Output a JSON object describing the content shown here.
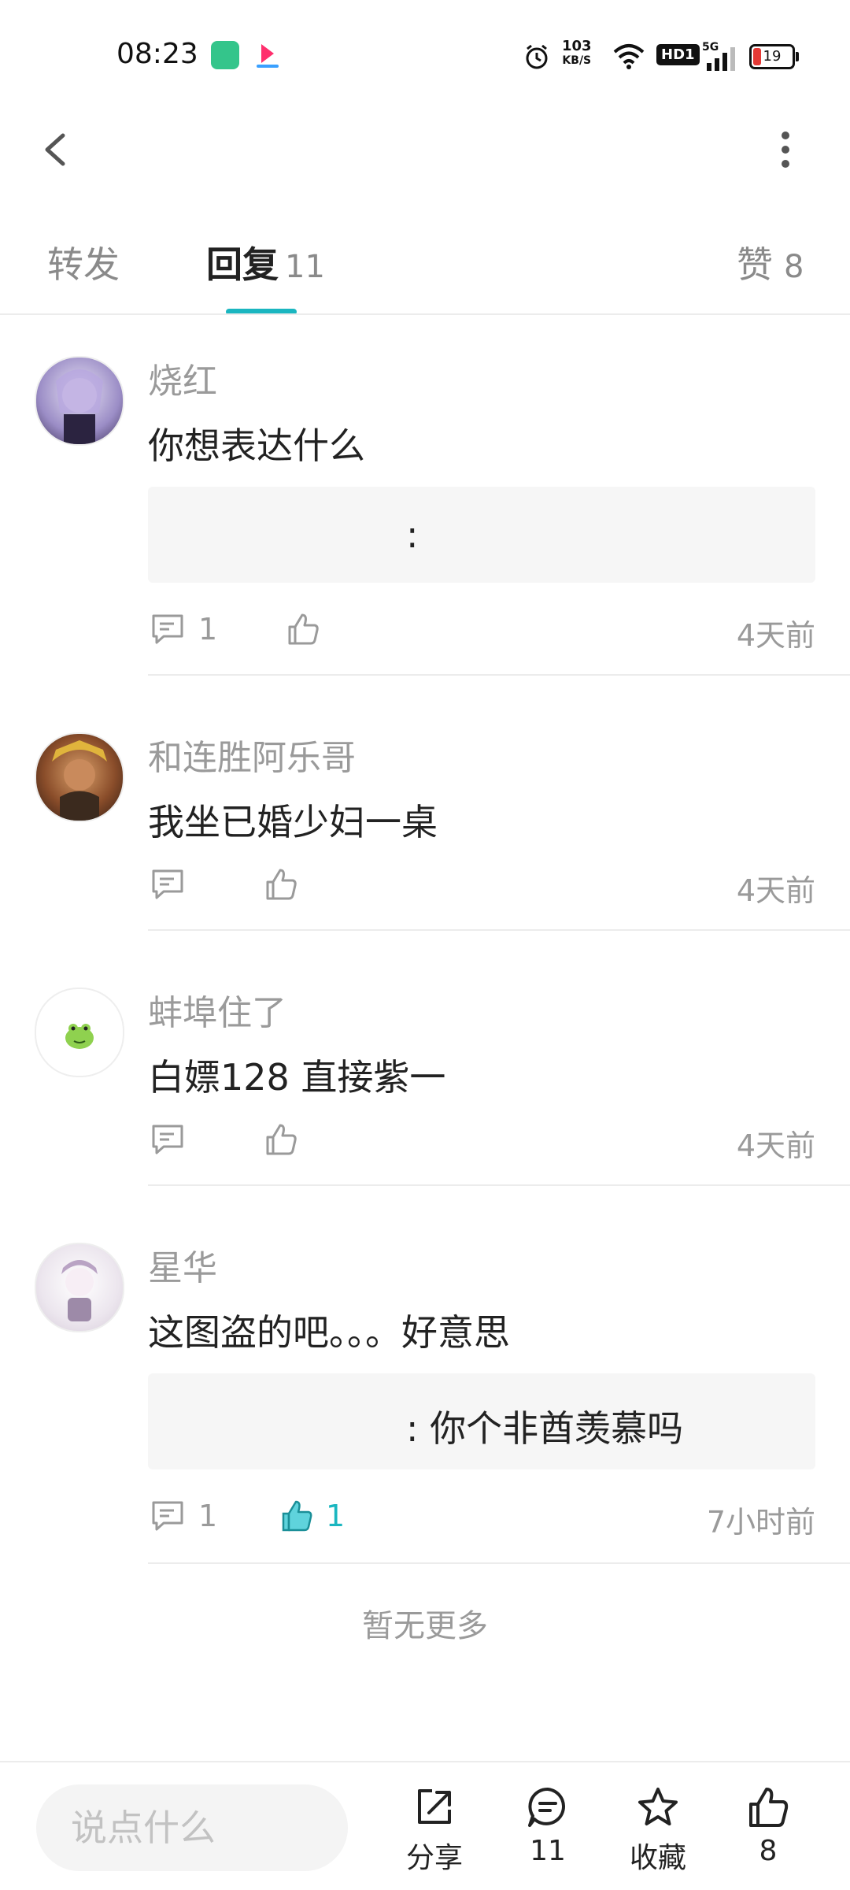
{
  "status_bar": {
    "time": "08:23",
    "network_speed_top": "103",
    "network_speed_bottom": "KB/S",
    "hd_label": "HD1",
    "signal_label": "5G",
    "battery": "19"
  },
  "tabs": [
    {
      "label": "转发",
      "count": ""
    },
    {
      "label": "回复",
      "count": "11"
    },
    {
      "label": "赞",
      "count": "8"
    }
  ],
  "colors": {
    "accent": "#1ab6c0"
  },
  "comments": [
    {
      "user": "烧红",
      "text": "你想表达什么",
      "quote": ":",
      "reply_count": "1",
      "like_count": "",
      "time": "4天前",
      "liked": false
    },
    {
      "user": "和连胜阿乐哥",
      "text": "我坐已婚少妇一桌",
      "quote": "",
      "reply_count": "",
      "like_count": "",
      "time": "4天前",
      "liked": false
    },
    {
      "user": "蚌埠住了",
      "text": "白嫖128  直接紫一",
      "quote": "",
      "reply_count": "",
      "like_count": "",
      "time": "4天前",
      "liked": false
    },
    {
      "user": "星华",
      "text": "这图盗的吧。。。好意思",
      "quote": ": 你个非酋羡慕吗",
      "reply_count": "1",
      "like_count": "1",
      "time": "7小时前",
      "liked": true
    }
  ],
  "no_more_text": "暂无更多",
  "bottom_bar": {
    "input_placeholder": "说点什么",
    "share_label": "分享",
    "comment_count": "11",
    "favorite_label": "收藏",
    "like_count": "8"
  }
}
